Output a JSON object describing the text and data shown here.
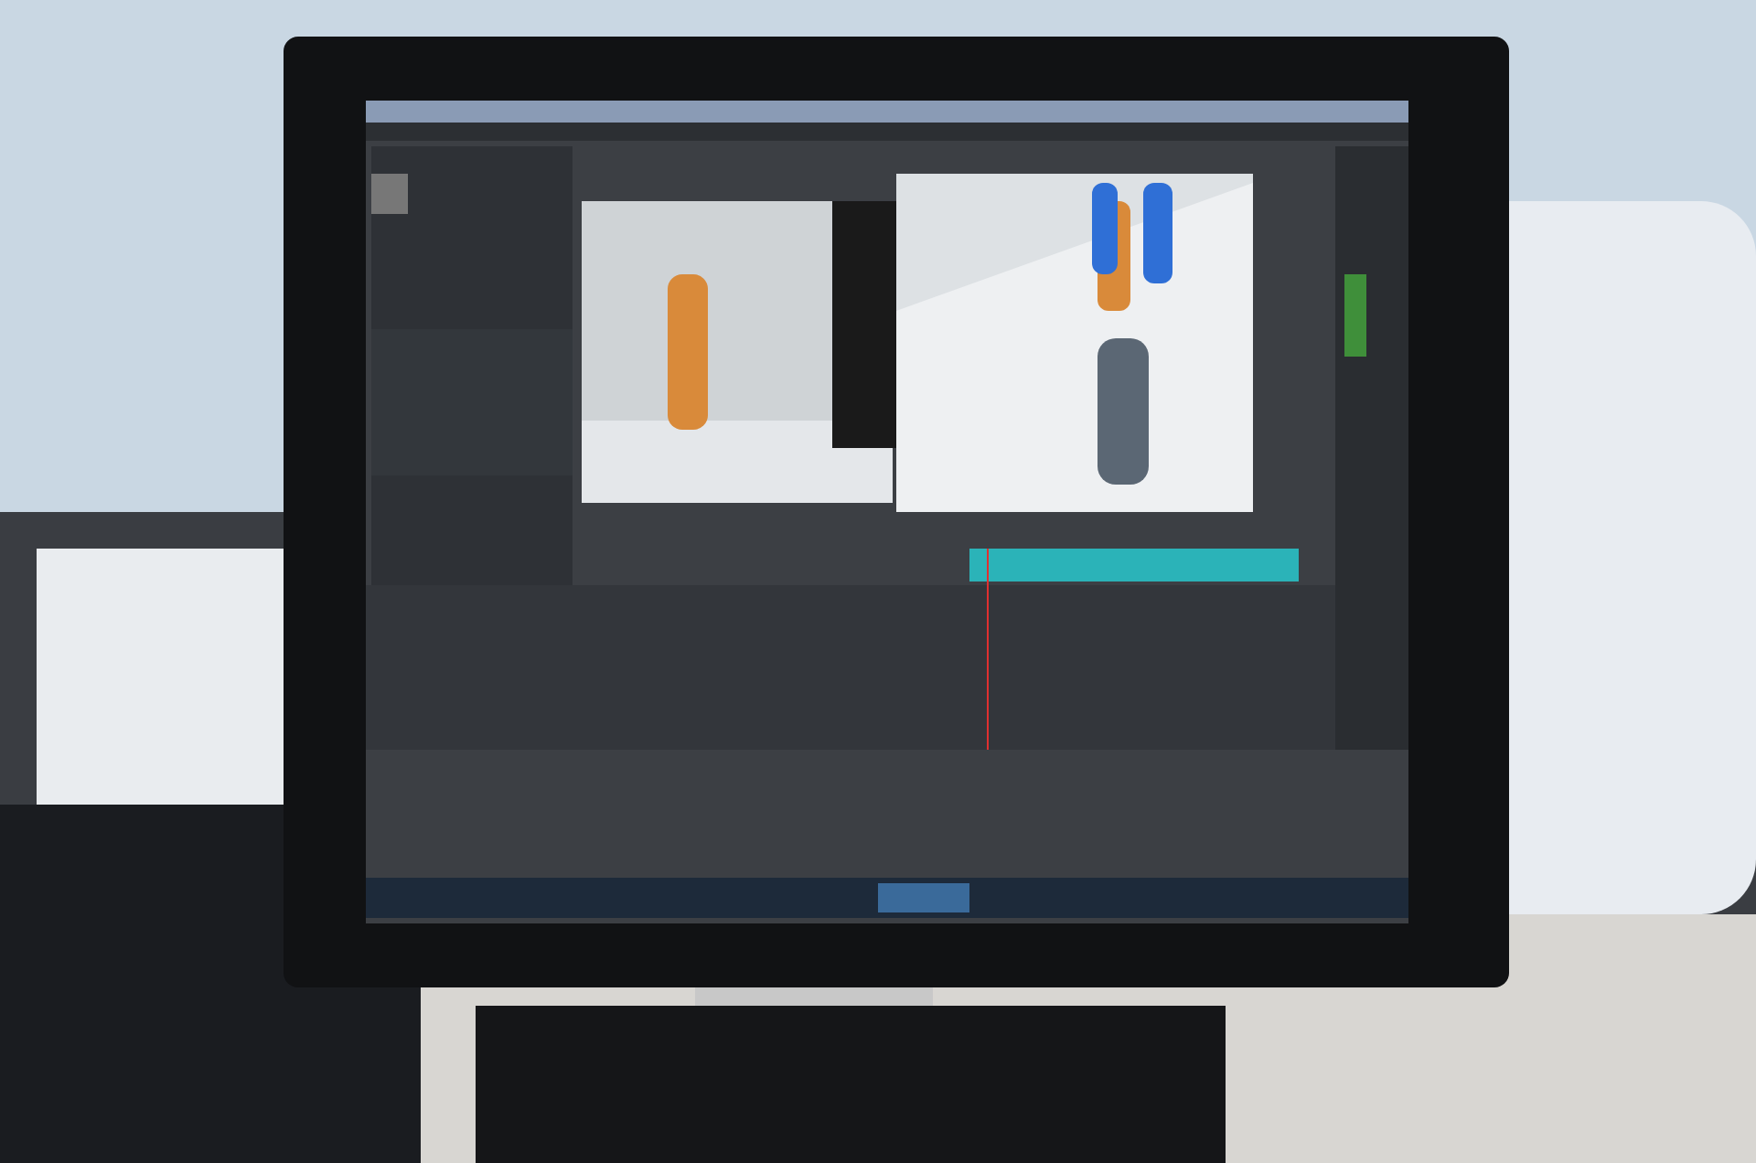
{
  "photo": {
    "kind": "photograph",
    "screen_on": true
  }
}
